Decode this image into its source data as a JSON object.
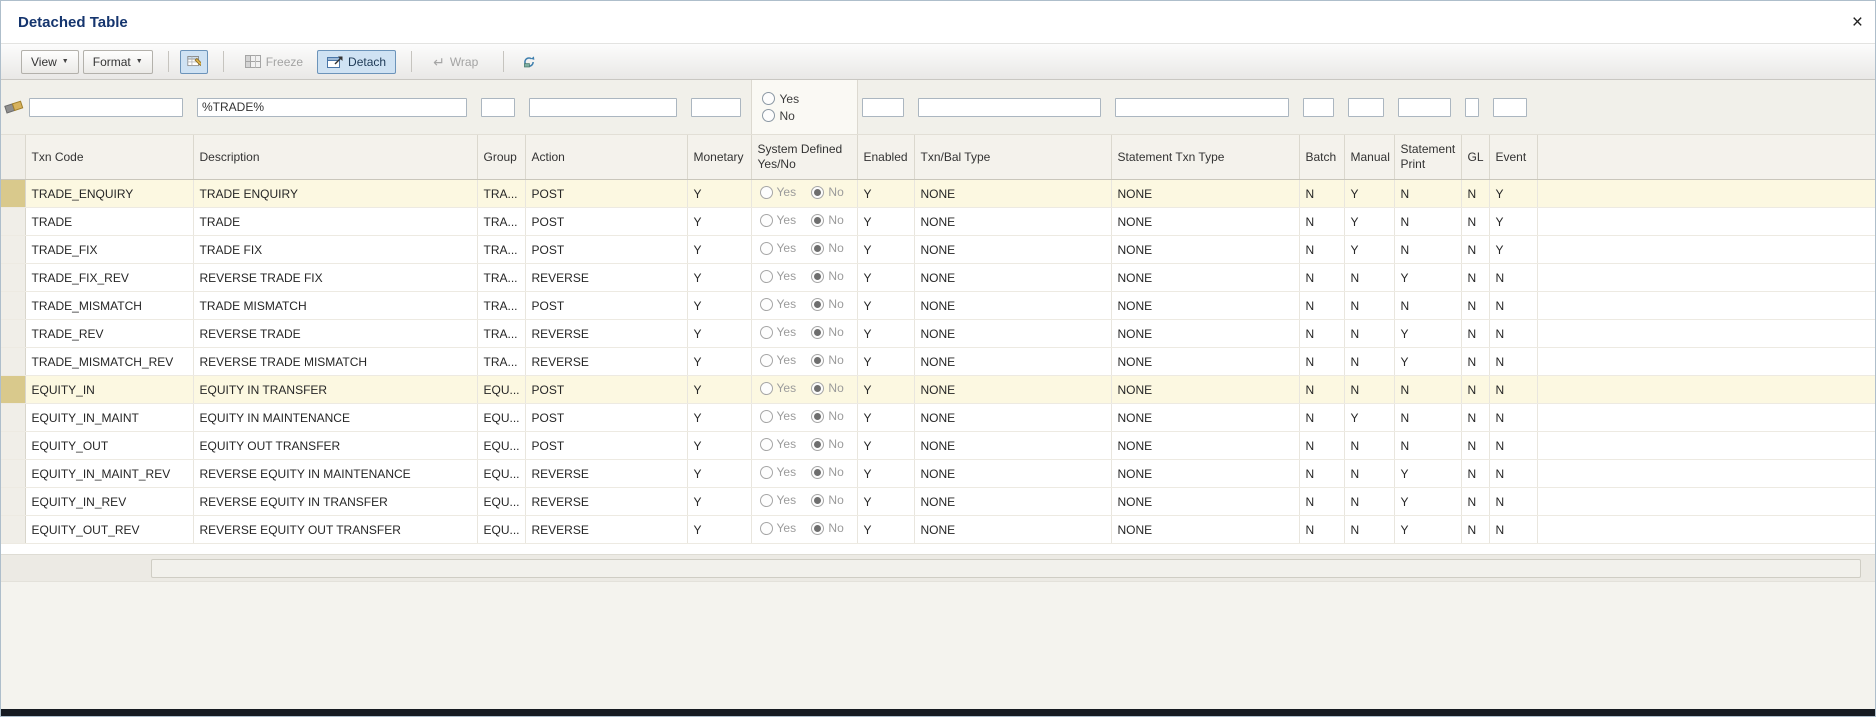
{
  "window": {
    "title": "Detached Table",
    "close_label": "×"
  },
  "toolbar": {
    "view_label": "View",
    "format_label": "Format",
    "freeze_label": "Freeze",
    "detach_label": "Detach",
    "wrap_label": "Wrap"
  },
  "filters": {
    "txn_code": "",
    "description": "%TRADE%",
    "group": "",
    "action": "",
    "monetary": "",
    "system_defined": {
      "yes_label": "Yes",
      "no_label": "No"
    },
    "enabled": "",
    "txn_bal_type": "",
    "statement_txn_type": "",
    "batch": "",
    "manual": "",
    "statement_print": "",
    "gl": "",
    "event": ""
  },
  "table": {
    "headers": [
      "Txn Code",
      "Description",
      "Group",
      "Action",
      "Monetary",
      "System Defined Yes/No",
      "Enabled",
      "Txn/Bal Type",
      "Statement Txn Type",
      "Batch",
      "Manual",
      "Statement Print",
      "GL",
      "Event"
    ],
    "radio_labels": {
      "yes": "Yes",
      "no": "No"
    },
    "rows": [
      {
        "txn_code": "TRADE_ENQUIRY",
        "description": "TRADE ENQUIRY",
        "group": "TRA...",
        "action": "POST",
        "monetary": "Y",
        "system_defined": "No",
        "enabled": "Y",
        "txn_bal_type": "NONE",
        "statement_txn_type": "NONE",
        "batch": "N",
        "manual": "Y",
        "statement_print": "N",
        "gl": "N",
        "event": "Y",
        "selected": true
      },
      {
        "txn_code": "TRADE",
        "description": "TRADE",
        "group": "TRA...",
        "action": "POST",
        "monetary": "Y",
        "system_defined": "No",
        "enabled": "Y",
        "txn_bal_type": "NONE",
        "statement_txn_type": "NONE",
        "batch": "N",
        "manual": "Y",
        "statement_print": "N",
        "gl": "N",
        "event": "Y",
        "selected": false
      },
      {
        "txn_code": "TRADE_FIX",
        "description": "TRADE FIX",
        "group": "TRA...",
        "action": "POST",
        "monetary": "Y",
        "system_defined": "No",
        "enabled": "Y",
        "txn_bal_type": "NONE",
        "statement_txn_type": "NONE",
        "batch": "N",
        "manual": "Y",
        "statement_print": "N",
        "gl": "N",
        "event": "Y",
        "selected": false
      },
      {
        "txn_code": "TRADE_FIX_REV",
        "description": "REVERSE TRADE FIX",
        "group": "TRA...",
        "action": "REVERSE",
        "monetary": "Y",
        "system_defined": "No",
        "enabled": "Y",
        "txn_bal_type": "NONE",
        "statement_txn_type": "NONE",
        "batch": "N",
        "manual": "N",
        "statement_print": "Y",
        "gl": "N",
        "event": "N",
        "selected": false
      },
      {
        "txn_code": "TRADE_MISMATCH",
        "description": "TRADE MISMATCH",
        "group": "TRA...",
        "action": "POST",
        "monetary": "Y",
        "system_defined": "No",
        "enabled": "Y",
        "txn_bal_type": "NONE",
        "statement_txn_type": "NONE",
        "batch": "N",
        "manual": "N",
        "statement_print": "N",
        "gl": "N",
        "event": "N",
        "selected": false
      },
      {
        "txn_code": "TRADE_REV",
        "description": "REVERSE TRADE",
        "group": "TRA...",
        "action": "REVERSE",
        "monetary": "Y",
        "system_defined": "No",
        "enabled": "Y",
        "txn_bal_type": "NONE",
        "statement_txn_type": "NONE",
        "batch": "N",
        "manual": "N",
        "statement_print": "Y",
        "gl": "N",
        "event": "N",
        "selected": false
      },
      {
        "txn_code": "TRADE_MISMATCH_REV",
        "description": "REVERSE TRADE MISMATCH",
        "group": "TRA...",
        "action": "REVERSE",
        "monetary": "Y",
        "system_defined": "No",
        "enabled": "Y",
        "txn_bal_type": "NONE",
        "statement_txn_type": "NONE",
        "batch": "N",
        "manual": "N",
        "statement_print": "Y",
        "gl": "N",
        "event": "N",
        "selected": false
      },
      {
        "txn_code": "EQUITY_IN",
        "description": "EQUITY IN TRANSFER",
        "group": "EQU...",
        "action": "POST",
        "monetary": "Y",
        "system_defined": "No",
        "enabled": "Y",
        "txn_bal_type": "NONE",
        "statement_txn_type": "NONE",
        "batch": "N",
        "manual": "N",
        "statement_print": "N",
        "gl": "N",
        "event": "N",
        "selected": true
      },
      {
        "txn_code": "EQUITY_IN_MAINT",
        "description": "EQUITY IN MAINTENANCE",
        "group": "EQU...",
        "action": "POST",
        "monetary": "Y",
        "system_defined": "No",
        "enabled": "Y",
        "txn_bal_type": "NONE",
        "statement_txn_type": "NONE",
        "batch": "N",
        "manual": "Y",
        "statement_print": "N",
        "gl": "N",
        "event": "N",
        "selected": false
      },
      {
        "txn_code": "EQUITY_OUT",
        "description": "EQUITY OUT TRANSFER",
        "group": "EQU...",
        "action": "POST",
        "monetary": "Y",
        "system_defined": "No",
        "enabled": "Y",
        "txn_bal_type": "NONE",
        "statement_txn_type": "NONE",
        "batch": "N",
        "manual": "N",
        "statement_print": "N",
        "gl": "N",
        "event": "N",
        "selected": false
      },
      {
        "txn_code": "EQUITY_IN_MAINT_REV",
        "description": "REVERSE EQUITY IN MAINTENANCE",
        "group": "EQU...",
        "action": "REVERSE",
        "monetary": "Y",
        "system_defined": "No",
        "enabled": "Y",
        "txn_bal_type": "NONE",
        "statement_txn_type": "NONE",
        "batch": "N",
        "manual": "N",
        "statement_print": "Y",
        "gl": "N",
        "event": "N",
        "selected": false
      },
      {
        "txn_code": "EQUITY_IN_REV",
        "description": "REVERSE EQUITY IN TRANSFER",
        "group": "EQU...",
        "action": "REVERSE",
        "monetary": "Y",
        "system_defined": "No",
        "enabled": "Y",
        "txn_bal_type": "NONE",
        "statement_txn_type": "NONE",
        "batch": "N",
        "manual": "N",
        "statement_print": "Y",
        "gl": "N",
        "event": "N",
        "selected": false
      },
      {
        "txn_code": "EQUITY_OUT_REV",
        "description": "REVERSE EQUITY OUT TRANSFER",
        "group": "EQU...",
        "action": "REVERSE",
        "monetary": "Y",
        "system_defined": "No",
        "enabled": "Y",
        "txn_bal_type": "NONE",
        "statement_txn_type": "NONE",
        "batch": "N",
        "manual": "N",
        "statement_print": "Y",
        "gl": "N",
        "event": "N",
        "selected": false
      }
    ]
  },
  "colors": {
    "title_text": "#15356e",
    "active_button_bg": "#cfe2f3",
    "active_button_border": "#6c94ba",
    "selected_row_bg": "#fcf8e1",
    "selected_row_gutter": "#d9c98c"
  }
}
